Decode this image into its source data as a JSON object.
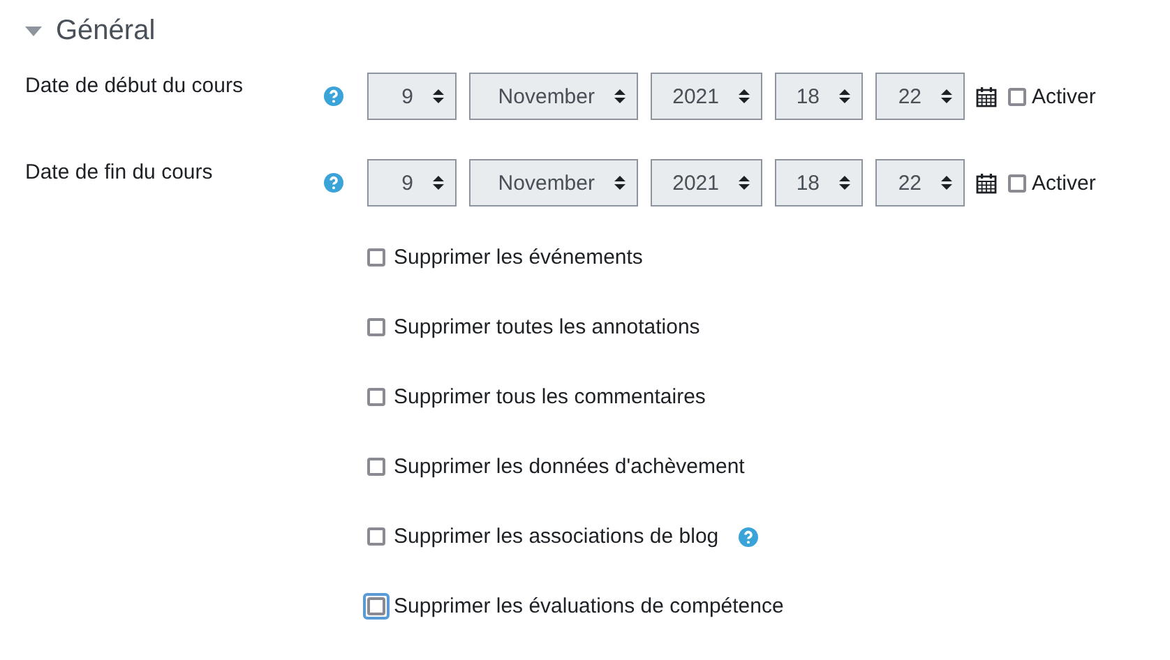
{
  "section": {
    "title": "Général",
    "expanded": true
  },
  "date_fields": [
    {
      "label": "Date de début du cours",
      "has_help": true,
      "selects": [
        "9",
        "November",
        "2021",
        "18",
        "22"
      ],
      "enable": {
        "label": "Activer",
        "checked": false
      }
    },
    {
      "label": "Date de fin du cours",
      "has_help": true,
      "selects": [
        "9",
        "November",
        "2021",
        "18",
        "22"
      ],
      "enable": {
        "label": "Activer",
        "checked": false
      }
    }
  ],
  "options": [
    {
      "label": "Supprimer les événements",
      "checked": false,
      "focused": false,
      "has_help": false
    },
    {
      "label": "Supprimer toutes les annotations",
      "checked": false,
      "focused": false,
      "has_help": false
    },
    {
      "label": "Supprimer tous les commentaires",
      "checked": false,
      "focused": false,
      "has_help": false
    },
    {
      "label": "Supprimer les données d'achèvement",
      "checked": false,
      "focused": false,
      "has_help": false
    },
    {
      "label": "Supprimer les associations de blog",
      "checked": false,
      "focused": false,
      "has_help": true
    },
    {
      "label": "Supprimer les évaluations de compétence",
      "checked": false,
      "focused": true,
      "has_help": false
    }
  ]
}
